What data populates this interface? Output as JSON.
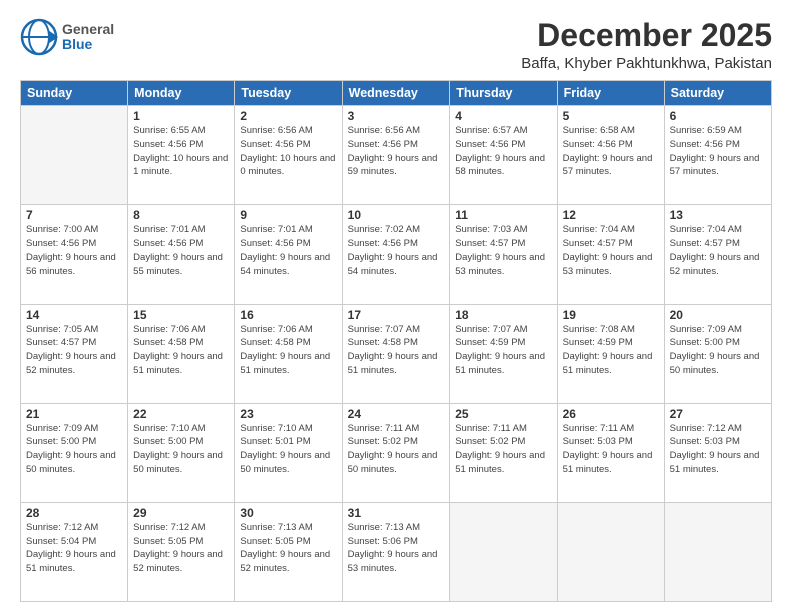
{
  "header": {
    "logo_general": "General",
    "logo_blue": "Blue",
    "month": "December 2025",
    "location": "Baffa, Khyber Pakhtunkhwa, Pakistan"
  },
  "weekdays": [
    "Sunday",
    "Monday",
    "Tuesday",
    "Wednesday",
    "Thursday",
    "Friday",
    "Saturday"
  ],
  "weeks": [
    [
      {
        "day": "",
        "sunrise": "",
        "sunset": "",
        "daylight": ""
      },
      {
        "day": "1",
        "sunrise": "Sunrise: 6:55 AM",
        "sunset": "Sunset: 4:56 PM",
        "daylight": "Daylight: 10 hours and 1 minute."
      },
      {
        "day": "2",
        "sunrise": "Sunrise: 6:56 AM",
        "sunset": "Sunset: 4:56 PM",
        "daylight": "Daylight: 10 hours and 0 minutes."
      },
      {
        "day": "3",
        "sunrise": "Sunrise: 6:56 AM",
        "sunset": "Sunset: 4:56 PM",
        "daylight": "Daylight: 9 hours and 59 minutes."
      },
      {
        "day": "4",
        "sunrise": "Sunrise: 6:57 AM",
        "sunset": "Sunset: 4:56 PM",
        "daylight": "Daylight: 9 hours and 58 minutes."
      },
      {
        "day": "5",
        "sunrise": "Sunrise: 6:58 AM",
        "sunset": "Sunset: 4:56 PM",
        "daylight": "Daylight: 9 hours and 57 minutes."
      },
      {
        "day": "6",
        "sunrise": "Sunrise: 6:59 AM",
        "sunset": "Sunset: 4:56 PM",
        "daylight": "Daylight: 9 hours and 57 minutes."
      }
    ],
    [
      {
        "day": "7",
        "sunrise": "Sunrise: 7:00 AM",
        "sunset": "Sunset: 4:56 PM",
        "daylight": "Daylight: 9 hours and 56 minutes."
      },
      {
        "day": "8",
        "sunrise": "Sunrise: 7:01 AM",
        "sunset": "Sunset: 4:56 PM",
        "daylight": "Daylight: 9 hours and 55 minutes."
      },
      {
        "day": "9",
        "sunrise": "Sunrise: 7:01 AM",
        "sunset": "Sunset: 4:56 PM",
        "daylight": "Daylight: 9 hours and 54 minutes."
      },
      {
        "day": "10",
        "sunrise": "Sunrise: 7:02 AM",
        "sunset": "Sunset: 4:56 PM",
        "daylight": "Daylight: 9 hours and 54 minutes."
      },
      {
        "day": "11",
        "sunrise": "Sunrise: 7:03 AM",
        "sunset": "Sunset: 4:57 PM",
        "daylight": "Daylight: 9 hours and 53 minutes."
      },
      {
        "day": "12",
        "sunrise": "Sunrise: 7:04 AM",
        "sunset": "Sunset: 4:57 PM",
        "daylight": "Daylight: 9 hours and 53 minutes."
      },
      {
        "day": "13",
        "sunrise": "Sunrise: 7:04 AM",
        "sunset": "Sunset: 4:57 PM",
        "daylight": "Daylight: 9 hours and 52 minutes."
      }
    ],
    [
      {
        "day": "14",
        "sunrise": "Sunrise: 7:05 AM",
        "sunset": "Sunset: 4:57 PM",
        "daylight": "Daylight: 9 hours and 52 minutes."
      },
      {
        "day": "15",
        "sunrise": "Sunrise: 7:06 AM",
        "sunset": "Sunset: 4:58 PM",
        "daylight": "Daylight: 9 hours and 51 minutes."
      },
      {
        "day": "16",
        "sunrise": "Sunrise: 7:06 AM",
        "sunset": "Sunset: 4:58 PM",
        "daylight": "Daylight: 9 hours and 51 minutes."
      },
      {
        "day": "17",
        "sunrise": "Sunrise: 7:07 AM",
        "sunset": "Sunset: 4:58 PM",
        "daylight": "Daylight: 9 hours and 51 minutes."
      },
      {
        "day": "18",
        "sunrise": "Sunrise: 7:07 AM",
        "sunset": "Sunset: 4:59 PM",
        "daylight": "Daylight: 9 hours and 51 minutes."
      },
      {
        "day": "19",
        "sunrise": "Sunrise: 7:08 AM",
        "sunset": "Sunset: 4:59 PM",
        "daylight": "Daylight: 9 hours and 51 minutes."
      },
      {
        "day": "20",
        "sunrise": "Sunrise: 7:09 AM",
        "sunset": "Sunset: 5:00 PM",
        "daylight": "Daylight: 9 hours and 50 minutes."
      }
    ],
    [
      {
        "day": "21",
        "sunrise": "Sunrise: 7:09 AM",
        "sunset": "Sunset: 5:00 PM",
        "daylight": "Daylight: 9 hours and 50 minutes."
      },
      {
        "day": "22",
        "sunrise": "Sunrise: 7:10 AM",
        "sunset": "Sunset: 5:00 PM",
        "daylight": "Daylight: 9 hours and 50 minutes."
      },
      {
        "day": "23",
        "sunrise": "Sunrise: 7:10 AM",
        "sunset": "Sunset: 5:01 PM",
        "daylight": "Daylight: 9 hours and 50 minutes."
      },
      {
        "day": "24",
        "sunrise": "Sunrise: 7:11 AM",
        "sunset": "Sunset: 5:02 PM",
        "daylight": "Daylight: 9 hours and 50 minutes."
      },
      {
        "day": "25",
        "sunrise": "Sunrise: 7:11 AM",
        "sunset": "Sunset: 5:02 PM",
        "daylight": "Daylight: 9 hours and 51 minutes."
      },
      {
        "day": "26",
        "sunrise": "Sunrise: 7:11 AM",
        "sunset": "Sunset: 5:03 PM",
        "daylight": "Daylight: 9 hours and 51 minutes."
      },
      {
        "day": "27",
        "sunrise": "Sunrise: 7:12 AM",
        "sunset": "Sunset: 5:03 PM",
        "daylight": "Daylight: 9 hours and 51 minutes."
      }
    ],
    [
      {
        "day": "28",
        "sunrise": "Sunrise: 7:12 AM",
        "sunset": "Sunset: 5:04 PM",
        "daylight": "Daylight: 9 hours and 51 minutes."
      },
      {
        "day": "29",
        "sunrise": "Sunrise: 7:12 AM",
        "sunset": "Sunset: 5:05 PM",
        "daylight": "Daylight: 9 hours and 52 minutes."
      },
      {
        "day": "30",
        "sunrise": "Sunrise: 7:13 AM",
        "sunset": "Sunset: 5:05 PM",
        "daylight": "Daylight: 9 hours and 52 minutes."
      },
      {
        "day": "31",
        "sunrise": "Sunrise: 7:13 AM",
        "sunset": "Sunset: 5:06 PM",
        "daylight": "Daylight: 9 hours and 53 minutes."
      },
      {
        "day": "",
        "sunrise": "",
        "sunset": "",
        "daylight": ""
      },
      {
        "day": "",
        "sunrise": "",
        "sunset": "",
        "daylight": ""
      },
      {
        "day": "",
        "sunrise": "",
        "sunset": "",
        "daylight": ""
      }
    ]
  ]
}
